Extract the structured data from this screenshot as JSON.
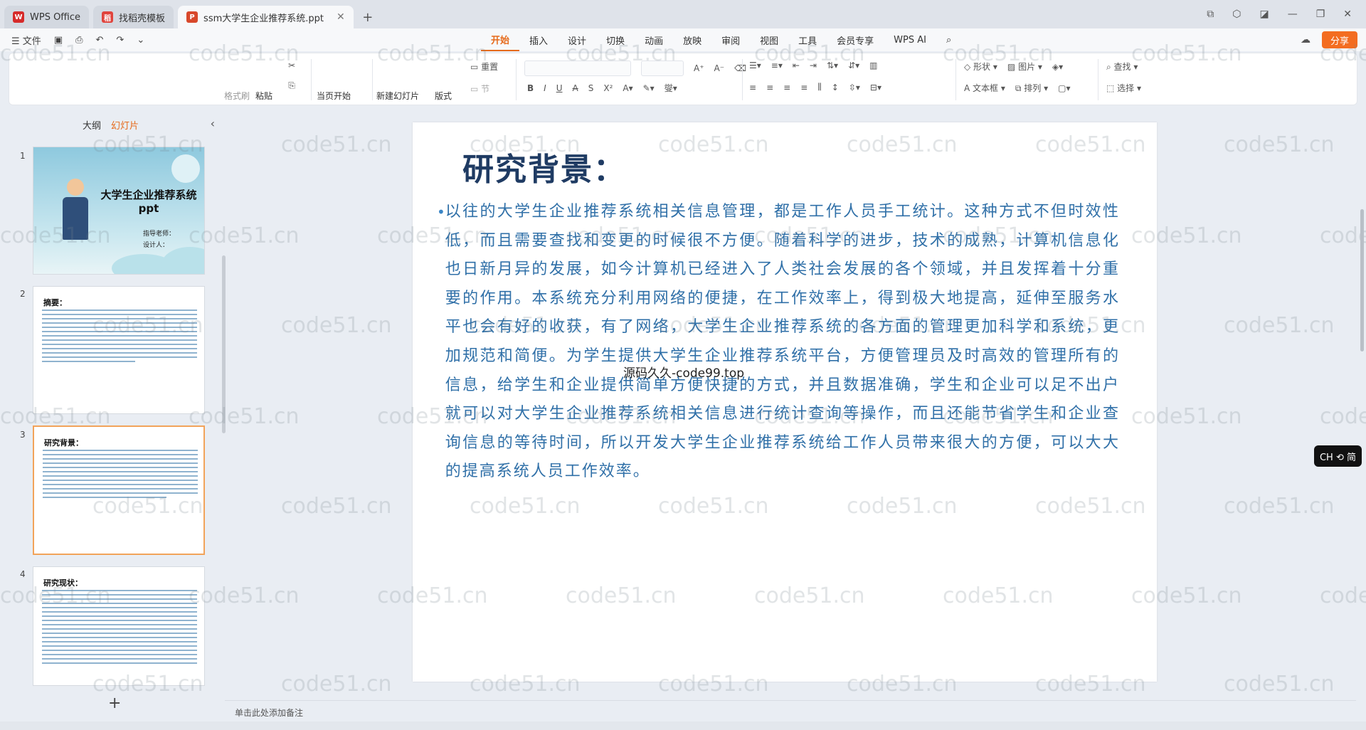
{
  "titlebar": {
    "tabs": [
      {
        "label": "WPS Office",
        "color": "#d62b2b"
      },
      {
        "label": "找稻壳模板",
        "color": "#e0443d"
      },
      {
        "label": "ssm大学生企业推荐系统.ppt",
        "color": "#d8482b"
      }
    ],
    "new_tab": "+"
  },
  "menu": {
    "file": "文件",
    "tabs": [
      "开始",
      "插入",
      "设计",
      "切换",
      "动画",
      "放映",
      "审阅",
      "视图",
      "工具",
      "会员专享",
      "WPS AI"
    ],
    "active_tab": "开始",
    "share": "分享"
  },
  "ribbon": {
    "format_painter": "格式刷",
    "paste": "粘贴",
    "start_show": "当页开始",
    "new_slide": "新建幻灯片",
    "layout": "版式",
    "reset": "重置",
    "section": "节",
    "shape": "形状",
    "picture": "图片",
    "find": "查找",
    "textbox": "文本框",
    "arrange": "排列",
    "select": "选择"
  },
  "left_panel": {
    "tab_outline": "大纲",
    "tab_slides": "幻灯片",
    "slides": [
      {
        "num": "1",
        "title": "大学生企业推荐系统ppt",
        "sub1": "指导老师：",
        "sub2": "设计人："
      },
      {
        "num": "2",
        "title": "摘要："
      },
      {
        "num": "3",
        "title": "研究背景："
      },
      {
        "num": "4",
        "title": "研究现状："
      }
    ]
  },
  "slide": {
    "title": "研究背景：",
    "body": "以往的大学生企业推荐系统相关信息管理，都是工作人员手工统计。这种方式不但时效性低，而且需要查找和变更的时候很不方便。随着科学的进步，技术的成熟，计算机信息化也日新月异的发展，如今计算机已经进入了人类社会发展的各个领域，并且发挥着十分重要的作用。本系统充分利用网络的便捷，在工作效率上，得到极大地提高，延伸至服务水平也会有好的收获，有了网络，大学生企业推荐系统的各方面的管理更加科学和系统，更加规范和简便。为学生提供大学生企业推荐系统平台，方便管理员及时高效的管理所有的信息，给学生和企业提供简单方便快捷的方式，并且数据准确，学生和企业可以足不出户就可以对大学生企业推荐系统相关信息进行统计查询等操作，而且还能节省学生和企业查询信息的等待时间，所以开发大学生企业推荐系统给工作人员带来很大的方便，可以大大的提高系统人员工作效率。"
  },
  "watermark": "code51.cn",
  "center_watermark": "源码久久-code99.top",
  "notes_placeholder": "单击此处添加备注",
  "ime": "CH ⟲ 简",
  "colors": {
    "accent": "#e66b1c",
    "title": "#1f3b63",
    "body": "#3070a8"
  }
}
